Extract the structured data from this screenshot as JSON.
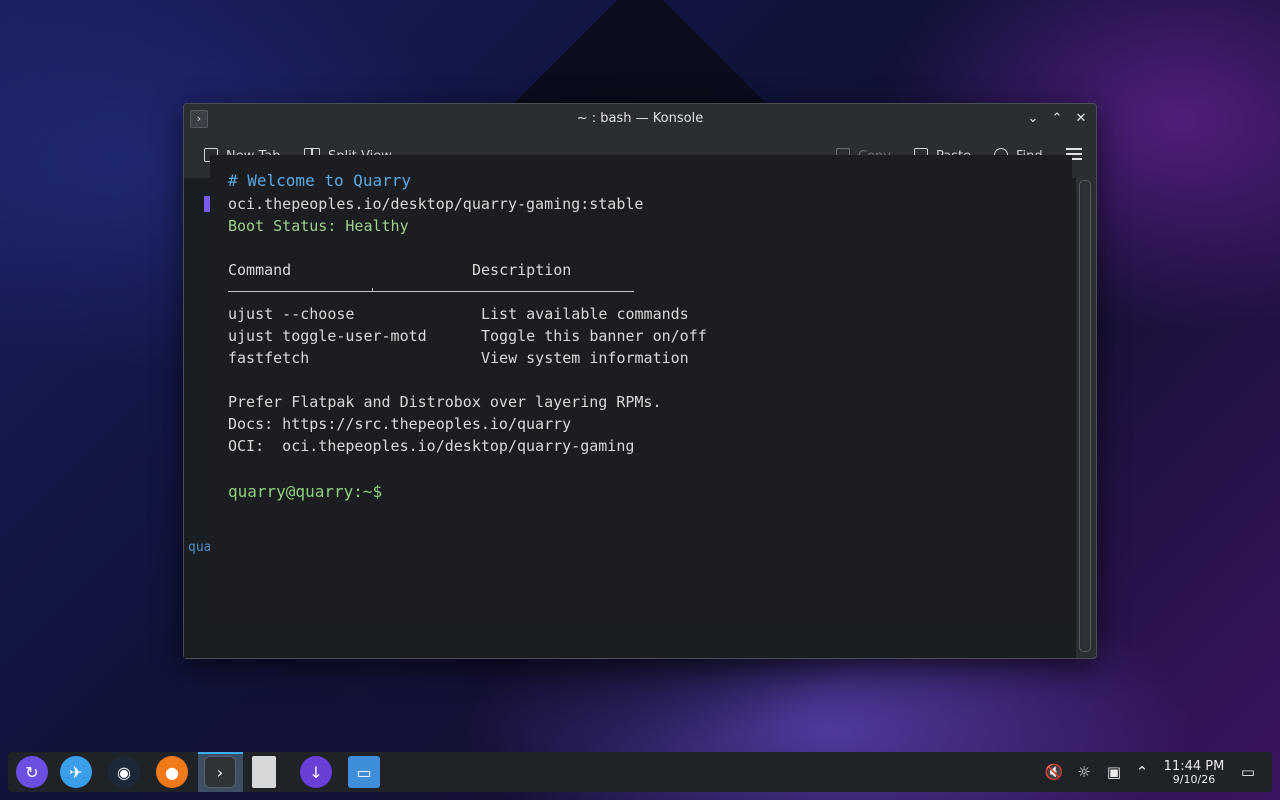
{
  "window": {
    "title": "~ : bash — Konsole",
    "app_icon": "terminal-icon",
    "buttons": {
      "minimize": "⌄",
      "maximize": "⌃",
      "close": "✕"
    }
  },
  "toolbar": {
    "new_tab": "New Tab",
    "split_view": "Split View",
    "copy": "Copy",
    "paste": "Paste",
    "find": "Find"
  },
  "background_terminal": {
    "prompt_fragment": "qua"
  },
  "terminal": {
    "heading": "# Welcome to Quarry",
    "image_ref": "oci.thepeoples.io/desktop/quarry-gaming:stable",
    "boot_status": "Boot Status: Healthy",
    "table": {
      "header_command": "Command",
      "header_description": "Description",
      "rows": [
        {
          "command": "ujust --choose",
          "description": "List available commands"
        },
        {
          "command": "ujust toggle-user-motd",
          "description": "Toggle this banner on/off"
        },
        {
          "command": "fastfetch",
          "description": "View system information"
        }
      ]
    },
    "tip": "Prefer Flatpak and Distrobox over layering RPMs.",
    "docs": "Docs: https://src.thepeoples.io/quarry",
    "oci": "OCI:  oci.thepeoples.io/desktop/quarry-gaming",
    "prompt": "quarry@quarry:~$"
  },
  "taskbar": {
    "apps": [
      {
        "name": "app-launcher-icon",
        "color": "#6b4fe0"
      },
      {
        "name": "discover-icon",
        "color": "#3a9ee8"
      },
      {
        "name": "steam-icon",
        "color": "#1b2838"
      },
      {
        "name": "firefox-icon",
        "color": "#f07a1a"
      },
      {
        "name": "konsole-icon",
        "color": "#2f3338"
      },
      {
        "name": "text-file-icon",
        "color": "#d8d8d8"
      },
      {
        "name": "downloader-icon",
        "color": "#6a3fd6"
      },
      {
        "name": "file-manager-icon",
        "color": "#3f8fd8"
      }
    ],
    "tray": [
      "volume-muted-icon",
      "brightness-icon",
      "network-icon",
      "expand-tray-icon"
    ],
    "clock": {
      "time": "11:44 PM",
      "date": "9/10/26"
    },
    "show_desktop": "show-desktop-icon"
  }
}
